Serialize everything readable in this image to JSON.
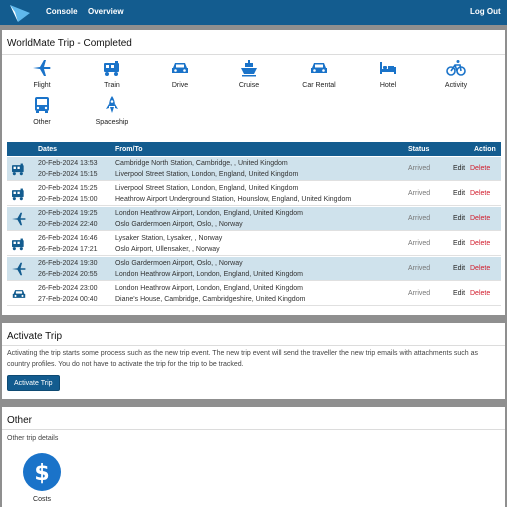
{
  "topbar": {
    "nav_console": "Console",
    "nav_overview": "Overview",
    "logout": "Log Out",
    "bg_color": "#135c8f"
  },
  "trip": {
    "title": "WorldMate Trip - Completed",
    "add_types": [
      {
        "label": "Flight",
        "icon": "plane-icon"
      },
      {
        "label": "Train",
        "icon": "train-icon"
      },
      {
        "label": "Drive",
        "icon": "car-icon"
      },
      {
        "label": "Cruise",
        "icon": "ship-icon"
      },
      {
        "label": "Car Rental",
        "icon": "car-rental-icon"
      },
      {
        "label": "Hotel",
        "icon": "bed-icon"
      },
      {
        "label": "Activity",
        "icon": "bicycle-icon"
      },
      {
        "label": "Other",
        "icon": "bus-icon"
      },
      {
        "label": "Spaceship",
        "icon": "rocket-icon"
      }
    ],
    "table": {
      "headers": {
        "dates": "Dates",
        "from_to": "From/To",
        "status": "Status",
        "action": "Action"
      },
      "edit_label": "Edit",
      "delete_label": "Delete",
      "rows": [
        {
          "icon": "train-icon",
          "date1": "20-Feb-2024 13:53",
          "date2": "20-Feb-2024 15:15",
          "from": "Cambridge North Station, Cambridge, , United Kingdom",
          "to": "Liverpool Street Station, London, England, United Kingdom",
          "status": "Arrived"
        },
        {
          "icon": "train-icon",
          "date1": "20-Feb-2024 15:25",
          "date2": "20-Feb-2024 15:00",
          "from": "Liverpool Street Station, London, England, United Kingdom",
          "to": "Heathrow Airport Underground Station, Hounslow, England, United Kingdom",
          "status": "Arrived"
        },
        {
          "icon": "plane-icon",
          "date1": "20-Feb-2024 19:25",
          "date2": "20-Feb-2024 22:40",
          "from": "London Heathrow Airport, London, England, United Kingdom",
          "to": "Oslo Gardermoen Airport, Oslo, , Norway",
          "status": "Arrived"
        },
        {
          "icon": "train-icon",
          "date1": "26-Feb-2024 16:46",
          "date2": "26-Feb-2024 17:21",
          "from": "Lysaker Station, Lysaker, , Norway",
          "to": "Oslo Airport, Ullensaker, , Norway",
          "status": "Arrived"
        },
        {
          "icon": "plane-icon",
          "date1": "26-Feb-2024 19:30",
          "date2": "26-Feb-2024 20:55",
          "from": "Oslo Gardermoen Airport, Oslo, , Norway",
          "to": "London Heathrow Airport, London, England, United Kingdom",
          "status": "Arrived"
        },
        {
          "icon": "car-icon",
          "date1": "26-Feb-2024 23:00",
          "date2": "27-Feb-2024 00:40",
          "from": "London Heathrow Airport, London, England, United Kingdom",
          "to": "Diane's House, Cambridge, Cambridgeshire, United Kingdom",
          "status": "Arrived"
        }
      ]
    }
  },
  "activate": {
    "title": "Activate Trip",
    "description": "Activating the trip starts some process such as the new trip event. The new trip event will send the traveller the new trip emails with attachments such as country profiles. You do not have to activate the trip for the trip to be tracked.",
    "button": "Activate Trip"
  },
  "other": {
    "title": "Other",
    "subtitle": "Other trip details",
    "costs_label": "Costs",
    "costs_icon": "dollar-icon"
  },
  "colors": {
    "accent": "#135c8f",
    "icon_blue": "#1a73c9",
    "delete_red": "#d11a2a",
    "row_alt": "#cfe2ec"
  }
}
